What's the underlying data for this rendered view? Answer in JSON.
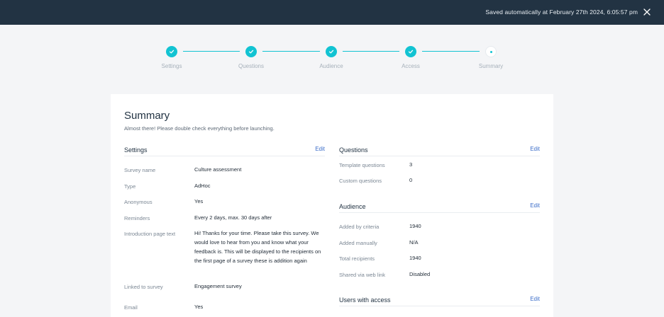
{
  "topbar": {
    "saved_text": "Saved automatically at February 27th 2024, 6:05:57 pm"
  },
  "stepper": {
    "steps": [
      {
        "label": "Settings",
        "status": "done"
      },
      {
        "label": "Questions",
        "status": "done"
      },
      {
        "label": "Audience",
        "status": "done"
      },
      {
        "label": "Access",
        "status": "done"
      },
      {
        "label": "Summary",
        "status": "current"
      }
    ]
  },
  "summary": {
    "title": "Summary",
    "subtitle": "Almost there! Please double check everything before launching.",
    "edit_label": "Edit",
    "settings": {
      "title": "Settings",
      "rows": [
        {
          "label": "Survey name",
          "value": "Culture assessment"
        },
        {
          "label": "Type",
          "value": "AdHoc"
        },
        {
          "label": "Anonymous",
          "value": "Yes"
        },
        {
          "label": "Reminders",
          "value": "Every 2 days, max. 30 days after"
        },
        {
          "label": "Introduction page text",
          "value": "Hi! Thanks for your time. Please take this survey. We would love to hear from you and know what your feedback is. This will be displayed to the recipients on the first page of a survey these is addition again"
        },
        {
          "label": "Linked to survey",
          "value": "Engagement survey"
        },
        {
          "label": "Email",
          "value": "Yes"
        }
      ]
    },
    "questions": {
      "title": "Questions",
      "rows": [
        {
          "label": "Template questions",
          "value": "3"
        },
        {
          "label": "Custom questions",
          "value": "0"
        }
      ]
    },
    "audience": {
      "title": "Audience",
      "rows": [
        {
          "label": "Added by criteria",
          "value": "1940"
        },
        {
          "label": "Added manually",
          "value": "N/A"
        },
        {
          "label": "Total recipients",
          "value": "1940"
        },
        {
          "label": "Shared via web link",
          "value": "Disabled"
        }
      ]
    },
    "access": {
      "title": "Users with access"
    }
  },
  "colors": {
    "topbar": "#223343",
    "accent": "#12c3d2",
    "link": "#3d6ec9",
    "background": "#f4f5f7"
  },
  "icons": [
    "close-icon",
    "check-icon"
  ]
}
